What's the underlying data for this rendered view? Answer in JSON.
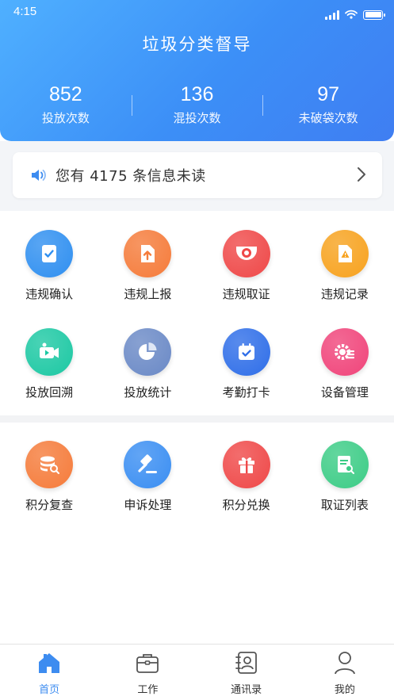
{
  "status": {
    "time": "4:15"
  },
  "header": {
    "title": "垃圾分类督导",
    "stats": [
      {
        "value": "852",
        "label": "投放次数"
      },
      {
        "value": "136",
        "label": "混投次数"
      },
      {
        "value": "97",
        "label": "未破袋次数"
      }
    ]
  },
  "notice": {
    "text": "您有 4175 条信息未读"
  },
  "grid1": [
    {
      "label": "违规确认",
      "icon": "document-check-icon",
      "color": "#2f8ff0"
    },
    {
      "label": "违规上报",
      "icon": "upload-file-icon",
      "color": "#f57b3a"
    },
    {
      "label": "违规取证",
      "icon": "camera-icon",
      "color": "#ef4848"
    },
    {
      "label": "违规记录",
      "icon": "warning-file-icon",
      "color": "#f7a21e"
    },
    {
      "label": "投放回溯",
      "icon": "video-icon",
      "color": "#1cc8a3"
    },
    {
      "label": "投放统计",
      "icon": "pie-chart-icon",
      "color": "#6a89c6"
    },
    {
      "label": "考勤打卡",
      "icon": "calendar-check-icon",
      "color": "#2f6ee8"
    },
    {
      "label": "设备管理",
      "icon": "gear-list-icon",
      "color": "#f0447a"
    }
  ],
  "grid2": [
    {
      "label": "积分复查",
      "icon": "coins-search-icon",
      "color": "#f57b3a"
    },
    {
      "label": "申诉处理",
      "icon": "gavel-icon",
      "color": "#3a8ef2"
    },
    {
      "label": "积分兑换",
      "icon": "gift-icon",
      "color": "#ef4848"
    },
    {
      "label": "取证列表",
      "icon": "list-search-icon",
      "color": "#3ccc86"
    }
  ],
  "tabs": [
    {
      "label": "首页",
      "icon": "home-icon",
      "active": true
    },
    {
      "label": "工作",
      "icon": "briefcase-icon",
      "active": false
    },
    {
      "label": "通讯录",
      "icon": "contacts-icon",
      "active": false
    },
    {
      "label": "我的",
      "icon": "person-icon",
      "active": false
    }
  ],
  "colors": {
    "header_start": "#4fb0ff",
    "header_end": "#3f7ef2",
    "active_tab": "#3d8cf0"
  }
}
